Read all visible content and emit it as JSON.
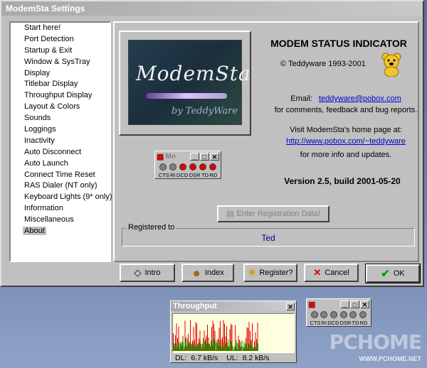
{
  "window": {
    "title": "ModemSta Settings"
  },
  "sidebar": {
    "items": [
      "Start here!",
      "Port Detection",
      "Startup & Exit",
      "Window & SysTray",
      "Display",
      "Titlebar Display",
      "Throughput Display",
      "Layout & Colors",
      "Sounds",
      "Loggings",
      "Inactivity",
      "Auto Disconnect",
      "Auto Launch",
      "Connect Time Reset",
      "RAS Dialer (NT only)",
      "Keyboard Lights (9* only)",
      "Information",
      "Miscellaneous",
      "About"
    ],
    "selected": "About"
  },
  "about": {
    "logo_text": "ModemSta",
    "logo_by": "by TeddyWare",
    "title": "MODEM STATUS INDICATOR",
    "copyright": "© Teddyware 1993-2001",
    "email_label": "Email:",
    "email": "teddyware@pobox.com",
    "email_note": "for comments, feedback and bug reports.",
    "home_label": "Visit ModemSta's home page at:",
    "home_url": "http://www.pobox.com/~teddyware",
    "home_note": "for more info and updates.",
    "version": "Version 2.5, build 2001-05-20",
    "register_button": "Enter Registration Data!",
    "registered_to_label": "Registered to",
    "registered_to": "Ted"
  },
  "mini_indicator": {
    "title": "Mo",
    "leds": [
      "CTS",
      "RI",
      "DCD",
      "DSR",
      "TD",
      "RD"
    ],
    "led_colors": [
      "#808080",
      "#808080",
      "#e00000",
      "#e00000",
      "#e00000",
      "#e00000"
    ]
  },
  "buttons": {
    "intro": "Intro",
    "index": "Index",
    "register": "Register?",
    "cancel": "Cancel",
    "ok": "OK"
  },
  "throughput": {
    "title": "Throughput",
    "dl_label": "DL:",
    "dl": "6.7 kB/s",
    "ul_label": "UL:",
    "ul": "8.2 kB/s"
  },
  "tray_indicator": {
    "leds": [
      "CTS",
      "RI",
      "DCD",
      "DSR",
      "TD",
      "RD"
    ]
  },
  "watermark": {
    "text": "PCHOME",
    "url": "WWW.PCHOME.NET"
  },
  "colors": {
    "link": "#0000cc",
    "led_on": "#e00000",
    "led_off": "#808080",
    "graph_red": "#e00000",
    "graph_green": "#00b000"
  }
}
